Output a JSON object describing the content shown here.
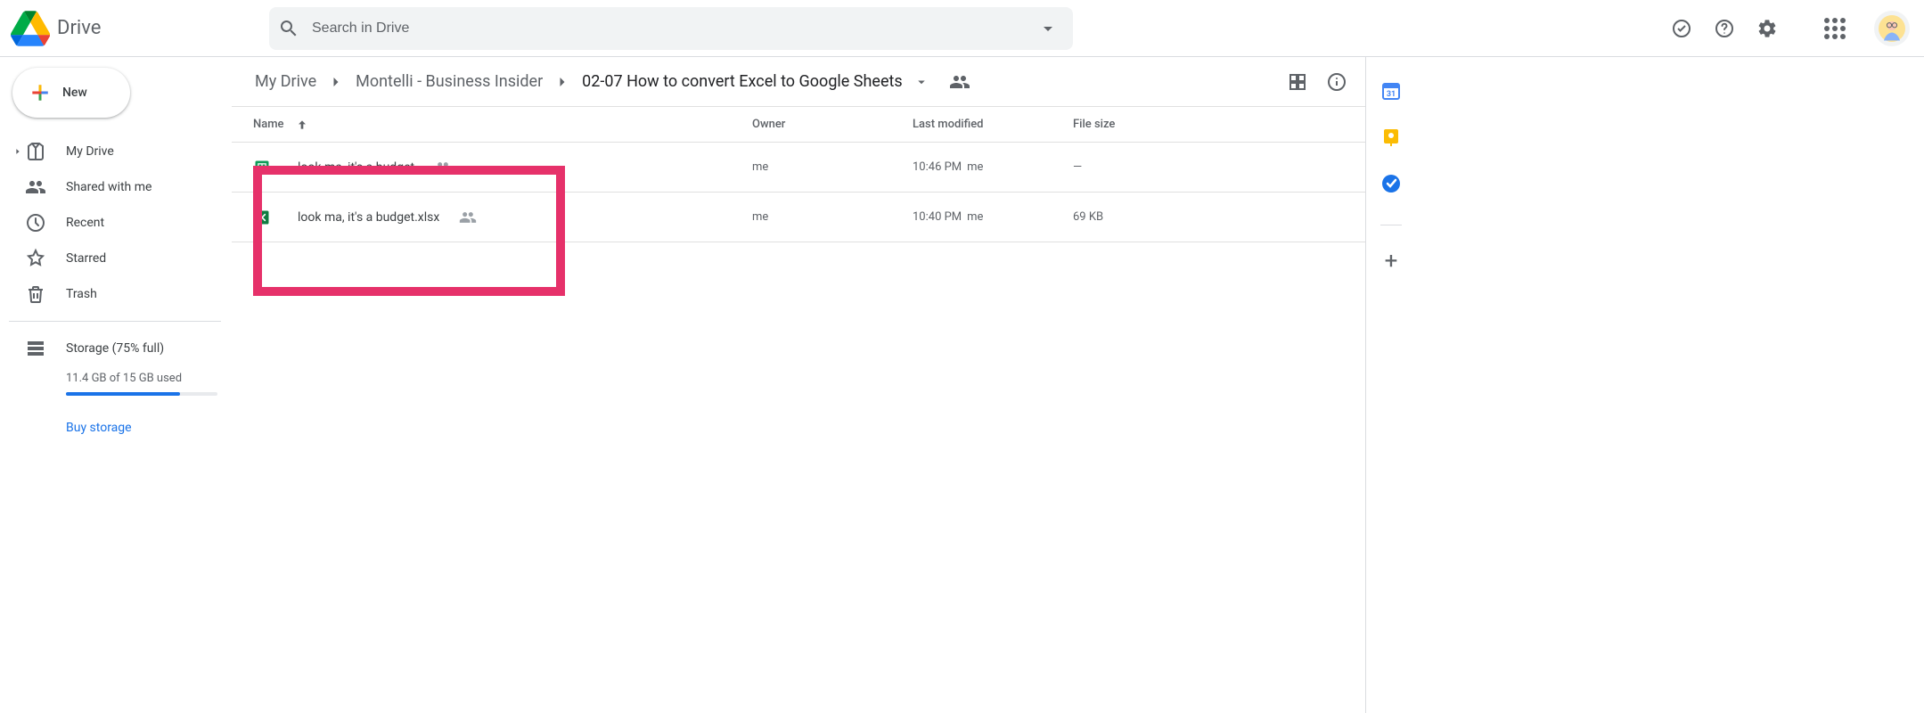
{
  "app_name": "Drive",
  "search_placeholder": "Search in Drive",
  "new_button_label": "New",
  "sidebar": {
    "items": [
      {
        "label": "My Drive"
      },
      {
        "label": "Shared with me"
      },
      {
        "label": "Recent"
      },
      {
        "label": "Starred"
      },
      {
        "label": "Trash"
      }
    ]
  },
  "storage": {
    "label": "Storage (75% full)",
    "usage": "11.4 GB of 15 GB used",
    "percent": 75,
    "buy_label": "Buy storage"
  },
  "breadcrumbs": [
    {
      "label": "My Drive"
    },
    {
      "label": "Montelli - Business Insider"
    },
    {
      "label": "02-07 How to convert Excel to Google Sheets"
    }
  ],
  "columns": {
    "name": "Name",
    "owner": "Owner",
    "modified": "Last modified",
    "size": "File size"
  },
  "files": [
    {
      "name": "look ma, it's a budget",
      "type": "sheets",
      "owner": "me",
      "modified": "10:46 PM",
      "modified_by": "me",
      "size": "—",
      "shared": true
    },
    {
      "name": "look ma, it's a budget.xlsx",
      "type": "excel",
      "owner": "me",
      "modified": "10:40 PM",
      "modified_by": "me",
      "size": "69 KB",
      "shared": true
    }
  ]
}
